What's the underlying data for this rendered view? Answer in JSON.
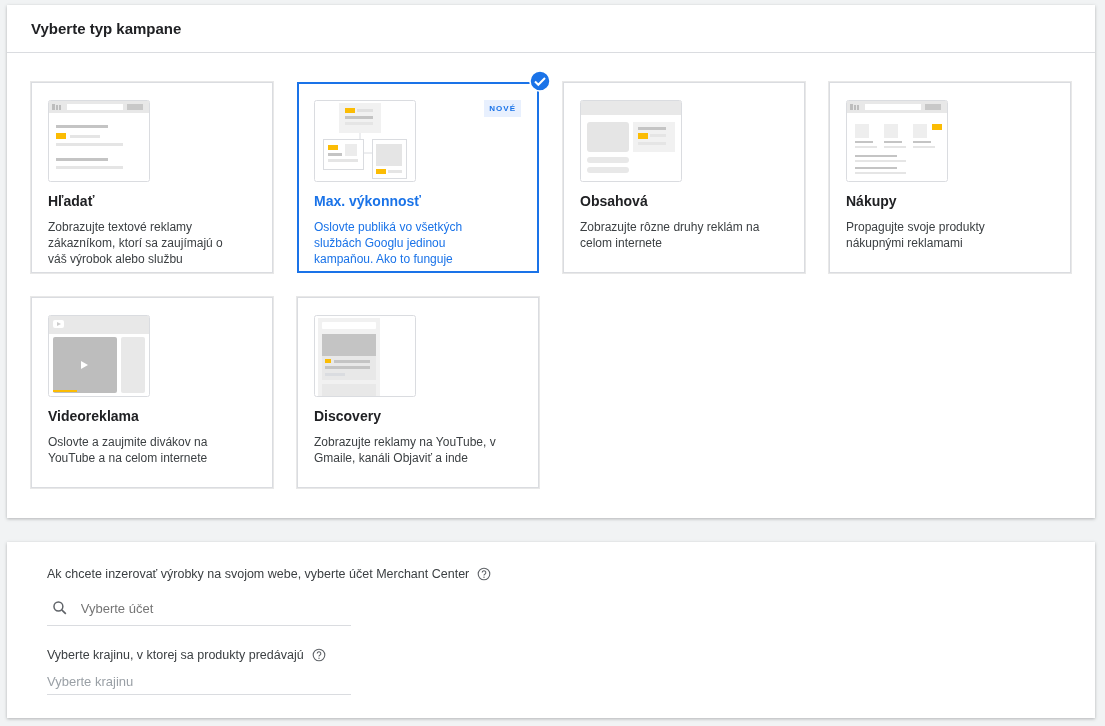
{
  "campaign_panel": {
    "title": "Vyberte typ kampane",
    "cards": [
      {
        "kind": "search",
        "title": "Hľadať",
        "description": "Zobrazujte textové reklamy zákazníkom, ktorí sa zaujímajú o váš výrobok alebo službu",
        "selected": false
      },
      {
        "kind": "performance",
        "title": "Max. výkonnosť",
        "badge": "NOVÉ",
        "description": "Oslovte publiká vo všetkých službách Googlu jedinou kampaňou.",
        "link": "Ako to funguje",
        "selected": true
      },
      {
        "kind": "display",
        "title": "Obsahová",
        "description": "Zobrazujte rôzne druhy reklám na celom internete",
        "selected": false
      },
      {
        "kind": "shopping",
        "title": "Nákupy",
        "description": "Propagujte svoje produkty nákupnými reklamami",
        "selected": false
      },
      {
        "kind": "video",
        "title": "Videoreklama",
        "description": "Oslovte a zaujmite divákov na YouTube a na celom internete",
        "selected": false
      },
      {
        "kind": "discovery",
        "title": "Discovery",
        "description": "Zobrazujte reklamy na YouTube, v Gmaile, kanáli Objaviť a inde",
        "selected": false
      }
    ]
  },
  "merchant_panel": {
    "fields": [
      {
        "kind": "search",
        "label": "Ak chcete inzerovať výrobky na svojom webe, vyberte účet Merchant Center",
        "placeholder": "Vyberte účet"
      },
      {
        "kind": "plain",
        "label": "Vyberte krajinu, v ktorej sa produkty predávajú",
        "placeholder": "Vyberte krajinu"
      }
    ]
  }
}
